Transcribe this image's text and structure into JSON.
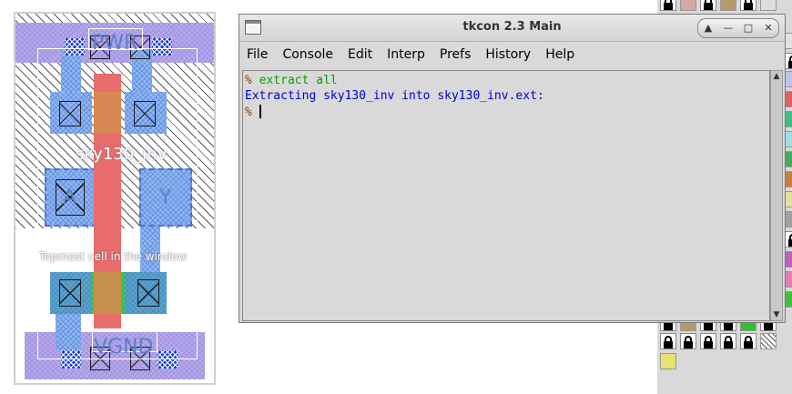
{
  "layout_view": {
    "pin_pwr": "PWR",
    "pin_a": "A",
    "pin_y": "Y",
    "pin_vgnd": "VGND",
    "cell_name": "sky130_inv",
    "top_cell_label": "Topmost cell in the window"
  },
  "tkcon": {
    "title": "tkcon 2.3 Main",
    "menu": [
      "File",
      "Console",
      "Edit",
      "Interp",
      "Prefs",
      "History",
      "Help"
    ],
    "window_buttons": {
      "up": "▲",
      "minimize": "—",
      "maximize": "□",
      "close": "✕"
    },
    "console": {
      "prompt": "%",
      "command": "extract all",
      "output": "Extracting sky130_inv into sky130_inv.ext:"
    }
  },
  "colors": {
    "poly": "#e86c6c",
    "local_interconnect": "#8fb6ee",
    "power_rail": "#b8a9e6",
    "command_text": "#00a000",
    "output_text": "#0000cc"
  }
}
